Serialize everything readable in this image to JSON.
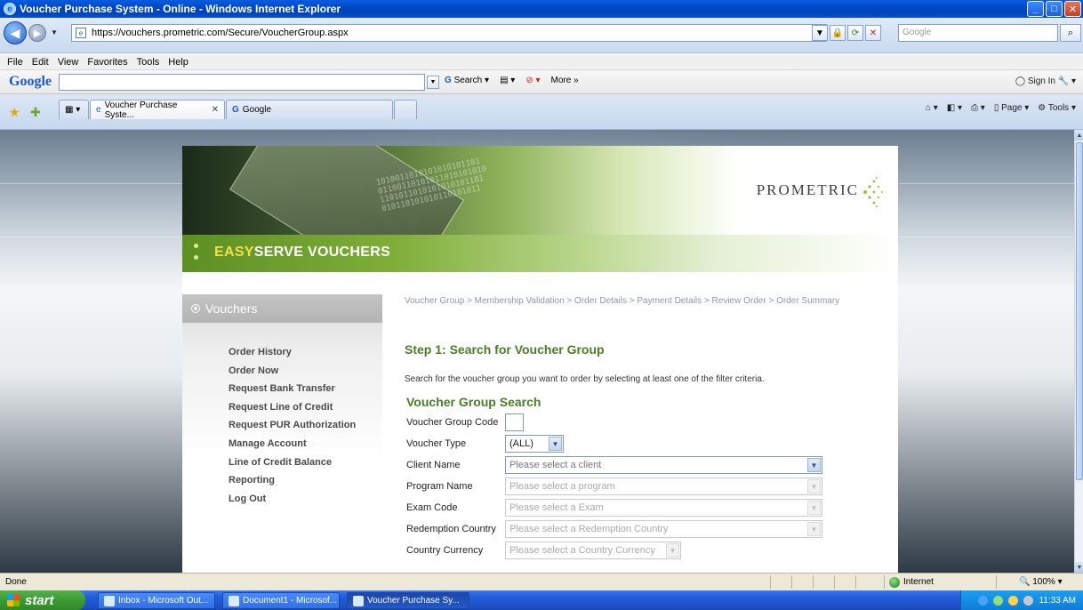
{
  "window": {
    "title": "Voucher Purchase System - Online - Windows Internet Explorer"
  },
  "addressbar": {
    "url": "https://vouchers.prometric.com/Secure/VoucherGroup.aspx",
    "search_placeholder": "Google"
  },
  "menubar": [
    "File",
    "Edit",
    "View",
    "Favorites",
    "Tools",
    "Help"
  ],
  "google_toolbar": {
    "logo": "Google",
    "search_label": "Search",
    "more_label": "More »",
    "signin_label": "Sign In"
  },
  "tabs": [
    {
      "label": "Voucher Purchase Syste...",
      "active": true
    },
    {
      "label": "Google",
      "active": false
    }
  ],
  "commandbar": {
    "page": "Page",
    "tools": "Tools"
  },
  "site": {
    "logo_text": "PROMETRIC",
    "brand_highlight": "EASY",
    "brand_rest": "SERVE VOUCHERS"
  },
  "sidebar": {
    "heading": "Vouchers",
    "items": [
      "Order History",
      "Order Now",
      "Request Bank Transfer",
      "Request Line of Credit",
      "Request PUR Authorization",
      "Manage Account",
      "Line of Credit Balance",
      "Reporting",
      "Log Out"
    ]
  },
  "main": {
    "breadcrumb": "Voucher Group > Membership Validation > Order Details > Payment Details > Review Order > Order Summary",
    "step_title": "Step 1: Search for Voucher Group",
    "intro": "Search for the voucher group you want to order by selecting at least one of the filter criteria.",
    "section_title": "Voucher Group Search",
    "fields": [
      {
        "label": "Voucher Group Code",
        "value": ""
      },
      {
        "label": "Voucher Type",
        "value": "(ALL)"
      },
      {
        "label": "Client Name",
        "value": "Please select a client"
      },
      {
        "label": "Program Name",
        "value": "Please select a program"
      },
      {
        "label": "Exam Code",
        "value": "Please select a Exam"
      },
      {
        "label": "Redemption Country",
        "value": "Please select a Redemption Country"
      },
      {
        "label": "Country Currency",
        "value": "Please select a Country Currency"
      }
    ]
  },
  "statusbar": {
    "status": "Done",
    "zone": "Internet",
    "zoom": "100%"
  },
  "taskbar": {
    "start": "start",
    "items": [
      "Inbox - Microsoft Out...",
      "Document1 - Microsof...",
      "Voucher Purchase Sy..."
    ],
    "clock": "11:33 AM"
  }
}
